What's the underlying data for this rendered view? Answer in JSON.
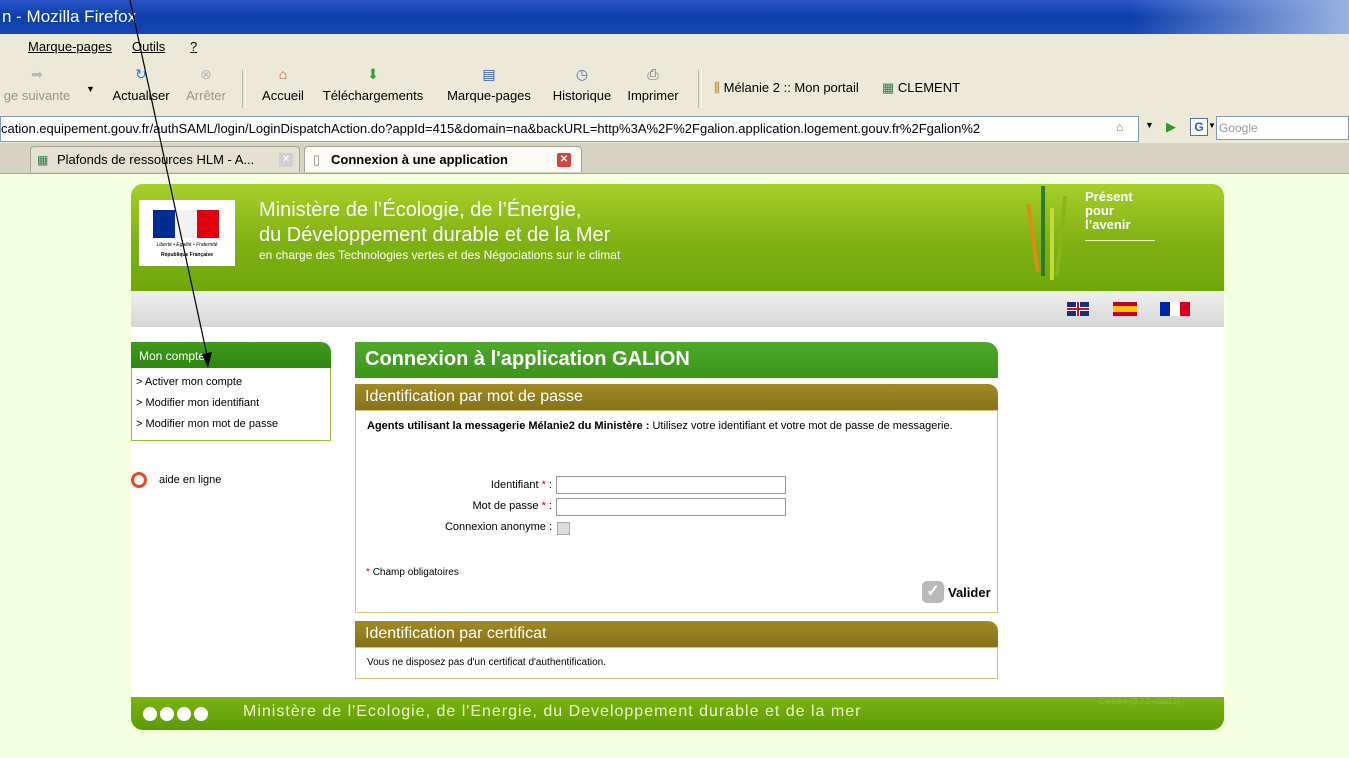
{
  "browser": {
    "title": "n - Mozilla Firefox",
    "menu": [
      "Marque-pages",
      "Outils",
      "?"
    ],
    "nav": {
      "next": "ge suivante",
      "reload": "Actualiser",
      "stop": "Arrêter",
      "home": "Accueil",
      "downloads": "Téléchargements",
      "bookmarks": "Marque-pages",
      "history": "Historique",
      "print": "Imprimer",
      "bookmark1": "Mélanie 2 :: Mon portail",
      "bookmark2": "CLEMENT"
    },
    "url": "cation.equipement.gouv.fr/authSAML/login/LoginDispatchAction.do?appId=415&domain=na&backURL=http%3A%2F%2Fgalion.application.logement.gouv.fr%2Fgalion%2",
    "search_placeholder": "Google",
    "tabs": [
      "Plafonds de ressources HLM - A...",
      "Connexion à une application"
    ]
  },
  "header": {
    "ministry_line1": "Ministère de l’Écologie, de l’Énergie,",
    "ministry_line2": "du Développement durable et de la Mer",
    "ministry_line3": "en charge des Technologies vertes et des Négociations sur le climat",
    "marianne_caption1": "Liberté • Égalité • Fraternité",
    "marianne_caption2": "République Française",
    "slogan1": "Présent",
    "slogan2": "pour",
    "slogan3": "l’avenir"
  },
  "sidebar": {
    "title": "Mon compte",
    "items": [
      "Activer mon compte",
      "Modifier mon identifiant",
      "Modifier mon mot de passe"
    ],
    "help": "aide en ligne"
  },
  "main": {
    "title": "Connexion à l'application GALION",
    "password_section": {
      "title": "Identification par mot de passe",
      "intro_bold": "Agents utilisant la messagerie Mélanie2 du Ministère :",
      "intro_rest": " Utilisez votre identifiant et votre mot de passe de messagerie.",
      "label_id": "Identifiant",
      "label_pwd": "Mot de passe",
      "label_anon": "Connexion anonyme :",
      "required_star": "*",
      "required_note": "Champ obligatoires",
      "submit": "Valider",
      "id_value": "",
      "pwd_value": ""
    },
    "cert_section": {
      "title": "Identification par certificat",
      "text": "Vous ne disposez pas d'un certificat d'authentification."
    }
  },
  "footer": {
    "text": "Ministère de l'Ecologie, de l'Energie, du Developpement durable et de la mer",
    "version": "Cerbère (3.7.2-ctsa12)"
  },
  "colors": {
    "green": "#7fb112",
    "olive": "#a08a24",
    "red": "#cc0000"
  }
}
